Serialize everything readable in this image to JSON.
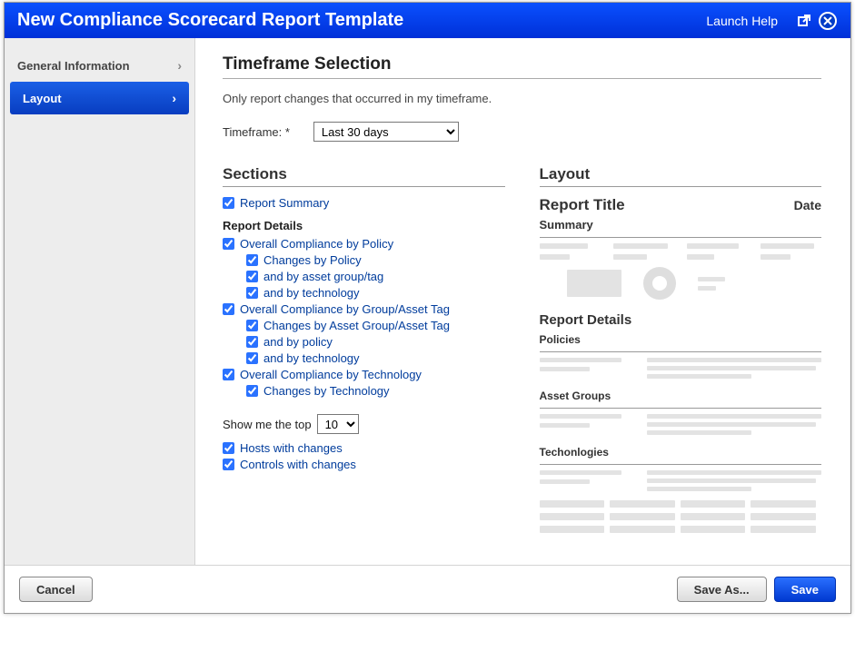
{
  "header": {
    "title": "New Compliance Scorecard Report Template",
    "help_label": "Launch Help",
    "popout_icon": "popout-icon",
    "close_icon": "close-icon"
  },
  "sidebar": {
    "items": [
      {
        "label": "General Information",
        "active": false
      },
      {
        "label": "Layout",
        "active": true
      }
    ]
  },
  "main": {
    "timeframe_title": "Timeframe Selection",
    "timeframe_note": "Only report changes that occurred in my timeframe.",
    "timeframe_label": "Timeframe: *",
    "timeframe_value": "Last 30 days",
    "sections_title": "Sections",
    "layout_title": "Layout",
    "report_summary": "Report Summary",
    "report_details_head": "Report Details",
    "cb_overall_policy": "Overall Compliance by Policy",
    "cb_changes_policy": "Changes by Policy",
    "cb_by_asset": "and by asset group/tag",
    "cb_by_tech": "and by technology",
    "cb_overall_group": "Overall Compliance by Group/Asset Tag",
    "cb_changes_group": "Changes by Asset Group/Asset Tag",
    "cb_by_policy": "and by policy",
    "cb_by_tech2": "and by technology",
    "cb_overall_tech": "Overall Compliance by Technology",
    "cb_changes_tech": "Changes by Technology",
    "show_top_pre": "Show me the top",
    "show_top_value": "10",
    "cb_hosts": "Hosts with changes",
    "cb_controls": "Controls with changes",
    "preview": {
      "title": "Report Title",
      "date": "Date",
      "summary": "Summary",
      "rd": "Report Details",
      "policies": "Policies",
      "asset_groups": "Asset Groups",
      "technologies": "Techonlogies"
    }
  },
  "footer": {
    "cancel": "Cancel",
    "saveas": "Save As...",
    "save": "Save"
  }
}
